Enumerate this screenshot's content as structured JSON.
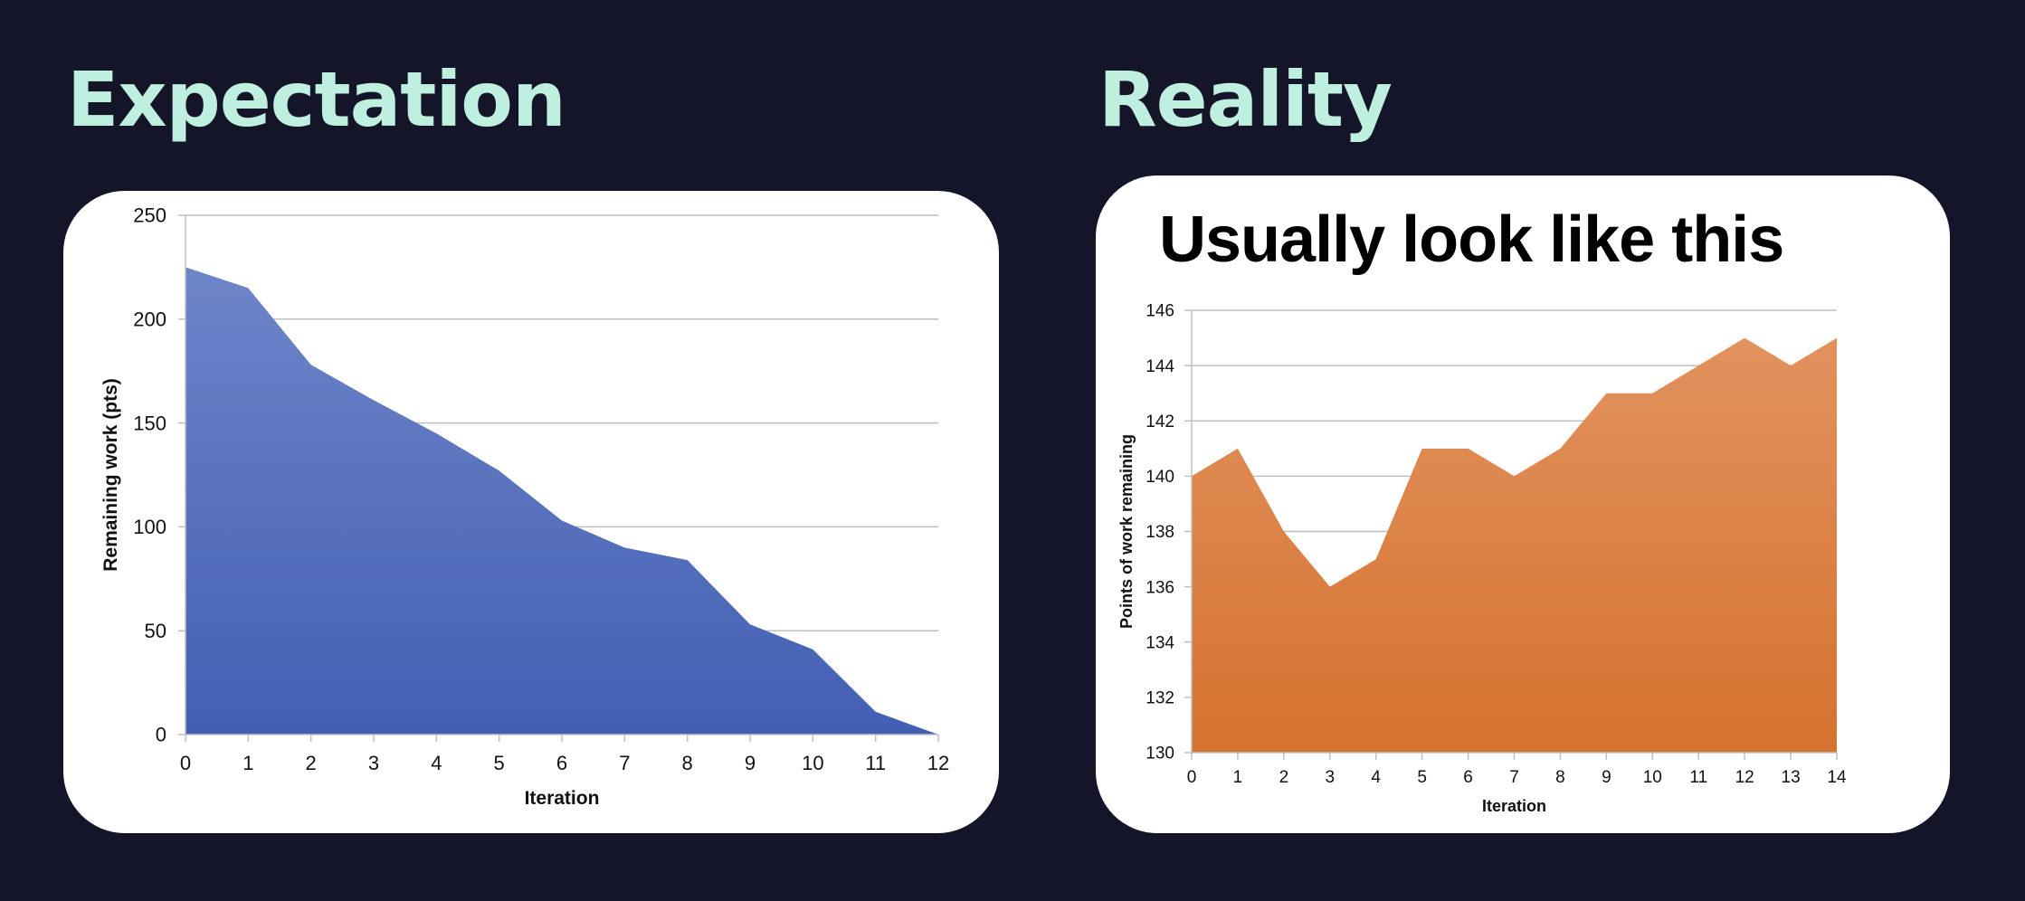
{
  "headings": {
    "left": "Expectation",
    "right": "Reality"
  },
  "colors": {
    "background": "#15152a",
    "heading": "#bff0df",
    "card": "#ffffff",
    "gridline": "#bfbfbf",
    "blue_top": "#6e85c9",
    "blue_bottom": "#425fb3",
    "orange_top": "#e2925e",
    "orange_bottom": "#d5722f"
  },
  "chart_data": [
    {
      "type": "area",
      "title": "",
      "xlabel": "Iteration",
      "ylabel": "Remaining work (pts)",
      "x": [
        0,
        1,
        2,
        3,
        4,
        5,
        6,
        7,
        8,
        9,
        10,
        11,
        12
      ],
      "values": [
        225,
        215,
        178,
        161,
        145,
        127,
        103,
        90,
        84,
        53,
        41,
        11,
        0
      ],
      "xlim": [
        0,
        12
      ],
      "ylim": [
        0,
        250
      ],
      "yticks": [
        0,
        50,
        100,
        150,
        200,
        250
      ],
      "xticks": [
        0,
        1,
        2,
        3,
        4,
        5,
        6,
        7,
        8,
        9,
        10,
        11,
        12
      ],
      "grid": true,
      "legend": "none",
      "fill": "blue"
    },
    {
      "type": "area",
      "title": "Usually look like this",
      "xlabel": "Iteration",
      "ylabel": "Points of work remaining",
      "x": [
        0,
        1,
        2,
        3,
        4,
        5,
        6,
        7,
        8,
        9,
        10,
        11,
        12,
        13,
        14
      ],
      "values": [
        140,
        141,
        138,
        136,
        137,
        141,
        141,
        140,
        141,
        143,
        143,
        144,
        145,
        144,
        145
      ],
      "xlim": [
        0,
        14
      ],
      "ylim": [
        130,
        146
      ],
      "yticks": [
        130,
        132,
        134,
        136,
        138,
        140,
        142,
        144,
        146
      ],
      "xticks": [
        0,
        1,
        2,
        3,
        4,
        5,
        6,
        7,
        8,
        9,
        10,
        11,
        12,
        13,
        14
      ],
      "grid": true,
      "legend": "none",
      "fill": "orange"
    }
  ]
}
